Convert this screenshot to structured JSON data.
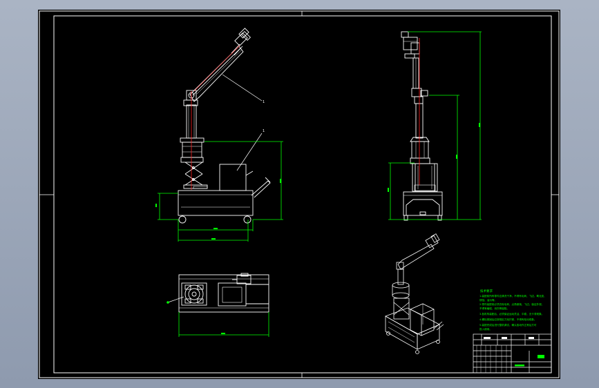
{
  "drawing": {
    "callouts": {
      "front_upper": "1",
      "front_lower": "1"
    },
    "technical_requirements": {
      "title": "技术要求",
      "lines": [
        "1.装配前所有零件应清洗干净，不得有毛刺、飞边、氧化皮、",
        "  锈蚀、油污等。",
        "2.零件装配前必须去除毛刺、尖角倒钝、飞边，保证外观，",
        "  不得有磕碰、划伤等缺陷。",
        "3.各机构装配后，必须保证运动灵活、平稳，无卡滞现象。",
        "4.螺栓紧固后应按规定力矩拧紧，不得有松动现象。",
        "5.装配完成后进行整机调试，确认各动作正常后方可",
        "  投入使用。"
      ]
    },
    "title_block": {
      "company": "",
      "drawing_no": "",
      "scale": "",
      "sheet": ""
    }
  },
  "colors": {
    "outline": "#ffffff",
    "dimension": "#00ff00",
    "centerline": "#ff2020",
    "leader": "#ffffff",
    "viewport": "#9aa6b8"
  }
}
